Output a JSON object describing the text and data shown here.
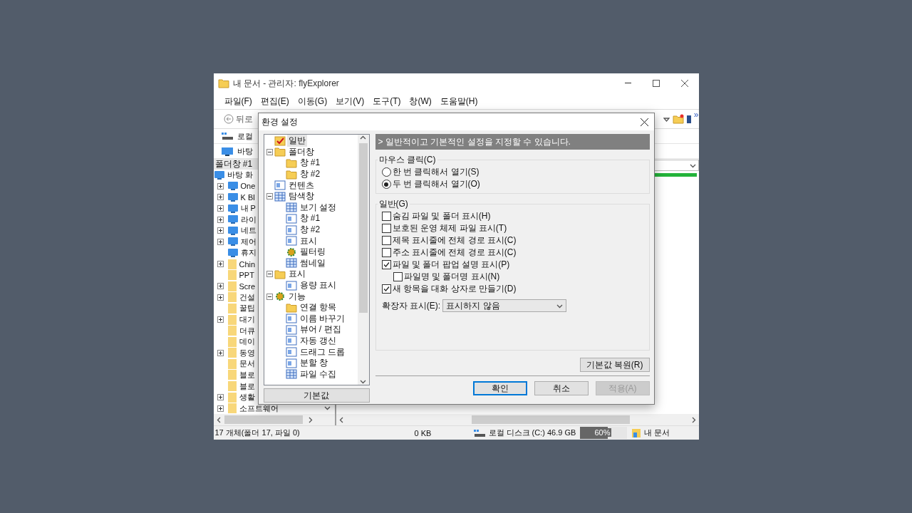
{
  "window": {
    "title": "내 문서 - 관리자: flyExplorer"
  },
  "menu": [
    "파일(F)",
    "편집(E)",
    "이동(G)",
    "보기(V)",
    "도구(T)",
    "창(W)",
    "도움말(H)"
  ],
  "toolbar": {
    "back": "뒤로",
    "overflow": "»"
  },
  "address_rows": [
    {
      "label": "로컬",
      "kind": "drive"
    },
    {
      "label": "바탕",
      "kind": "monitor"
    }
  ],
  "folder_pane": {
    "title": "폴더창 #1",
    "tree": [
      {
        "label": "바탕 화",
        "kind": "system",
        "children": [
          {
            "label": "One",
            "kind": "system",
            "expanded": false
          },
          {
            "label": "K Bl",
            "kind": "system",
            "expanded": false
          },
          {
            "label": "내 P",
            "kind": "system",
            "expanded": false
          },
          {
            "label": "라이",
            "kind": "system",
            "expanded": false
          },
          {
            "label": "네트",
            "kind": "system",
            "expanded": false
          },
          {
            "label": "제어",
            "kind": "system",
            "expanded": false
          },
          {
            "label": "휴지",
            "kind": "system"
          },
          {
            "label": "Chin",
            "kind": "folder",
            "expanded": false
          },
          {
            "label": "PPT",
            "kind": "folder"
          },
          {
            "label": "Scre",
            "kind": "folder",
            "expanded": false
          },
          {
            "label": "건설",
            "kind": "folder",
            "expanded": false
          },
          {
            "label": "꿀팁",
            "kind": "folder"
          },
          {
            "label": "대기",
            "kind": "folder",
            "expanded": false
          },
          {
            "label": "더큐",
            "kind": "folder"
          },
          {
            "label": "데이",
            "kind": "folder"
          },
          {
            "label": "동영",
            "kind": "folder",
            "expanded": false
          },
          {
            "label": "문서",
            "kind": "folder"
          },
          {
            "label": "블로",
            "kind": "folder"
          },
          {
            "label": "블로",
            "kind": "folder"
          },
          {
            "label": "생활",
            "kind": "folder",
            "expanded": false
          },
          {
            "label": "소프트웨어",
            "kind": "folder",
            "expanded": false
          }
        ]
      }
    ]
  },
  "status_bar": {
    "count": "17 개체(폴더 17, 파일 0)",
    "size": "0 KB",
    "drive": "로컬 디스크 (C:) 46.9 GB",
    "usage": {
      "level": 0.6,
      "reading": "60%"
    },
    "location": "내 문서"
  },
  "dialog": {
    "title": "환경 설정",
    "tree": [
      {
        "label": "일반",
        "kind": "check",
        "selected": true
      },
      {
        "label": "폴더창",
        "kind": "folder",
        "selected": false,
        "expanded": true,
        "children": [
          {
            "label": "창 #1",
            "kind": "folder",
            "selected": false
          },
          {
            "label": "창 #2",
            "kind": "folder",
            "selected": false
          }
        ]
      },
      {
        "label": "컨텐츠",
        "kind": "page",
        "selected": false
      },
      {
        "label": "탐색창",
        "kind": "grid",
        "selected": false,
        "expanded": true,
        "children": [
          {
            "label": "보기 설정",
            "kind": "grid",
            "selected": false
          },
          {
            "label": "창 #1",
            "kind": "page",
            "selected": false
          },
          {
            "label": "창 #2",
            "kind": "page",
            "selected": false
          },
          {
            "label": "표시",
            "kind": "page",
            "selected": false
          },
          {
            "label": "필터링",
            "kind": "gear",
            "selected": false
          },
          {
            "label": "썸네일",
            "kind": "grid",
            "selected": false
          }
        ]
      },
      {
        "label": "표시",
        "kind": "folder",
        "selected": false,
        "expanded": true,
        "children": [
          {
            "label": "용량 표시",
            "kind": "page",
            "selected": false
          }
        ]
      },
      {
        "label": "기능",
        "kind": "gear",
        "selected": false,
        "expanded": true,
        "children": [
          {
            "label": "연결 항목",
            "kind": "folder",
            "selected": false
          },
          {
            "label": "이름 바꾸기",
            "kind": "page",
            "selected": false
          },
          {
            "label": "뷰어 / 편집",
            "kind": "page",
            "selected": false
          },
          {
            "label": "자동 갱신",
            "kind": "page",
            "selected": false
          },
          {
            "label": "드래그 드롭",
            "kind": "page",
            "selected": false
          },
          {
            "label": "분할 창",
            "kind": "page",
            "selected": false
          },
          {
            "label": "파일 수집",
            "kind": "grid",
            "selected": false
          }
        ]
      }
    ],
    "defaults_button": "기본값",
    "header": "> 일반적이고 기본적인 설정을 지정할 수 있습니다.",
    "groups": [
      {
        "title": "마우스 클릭(C)",
        "items": [
          {
            "kind": "radio",
            "label": "한 번 클릭해서 열기(S)",
            "selected": false
          },
          {
            "kind": "radio",
            "label": "두 번 클릭해서 열기(O)",
            "selected": true
          }
        ]
      },
      {
        "title": "일반(G)",
        "items": [
          {
            "kind": "checkbox",
            "label": "숨김 파일 및 폴더 표시(H)",
            "checked": false
          },
          {
            "kind": "checkbox",
            "label": "보호된 운영 체제 파일 표시(T)",
            "checked": false
          },
          {
            "kind": "checkbox",
            "label": "제목 표시줄에 전체 경로 표시(C)",
            "checked": false
          },
          {
            "kind": "checkbox",
            "label": "주소 표시줄에 전체 경로 표시(C)",
            "checked": false
          },
          {
            "kind": "checkbox",
            "label": "파일 및 폴더 팝업 설명 표시(P)",
            "checked": true,
            "children": [
              {
                "kind": "checkbox",
                "label": "파일명 및 폴더명 표시(N)",
                "checked": false
              }
            ]
          },
          {
            "kind": "checkbox",
            "label": "새 항목을 대화 상자로 만들기(D)",
            "checked": true
          }
        ]
      }
    ],
    "extension": {
      "label": "확장자 표시(E):",
      "value": "표시하지 않음"
    },
    "restore_button": "기본값 복원(R)",
    "buttons": [
      {
        "label": "확인",
        "kind": "default",
        "disabled": false
      },
      {
        "label": "취소",
        "kind": "normal",
        "disabled": false
      },
      {
        "label": "적용(A)",
        "kind": "normal",
        "disabled": true
      }
    ]
  }
}
